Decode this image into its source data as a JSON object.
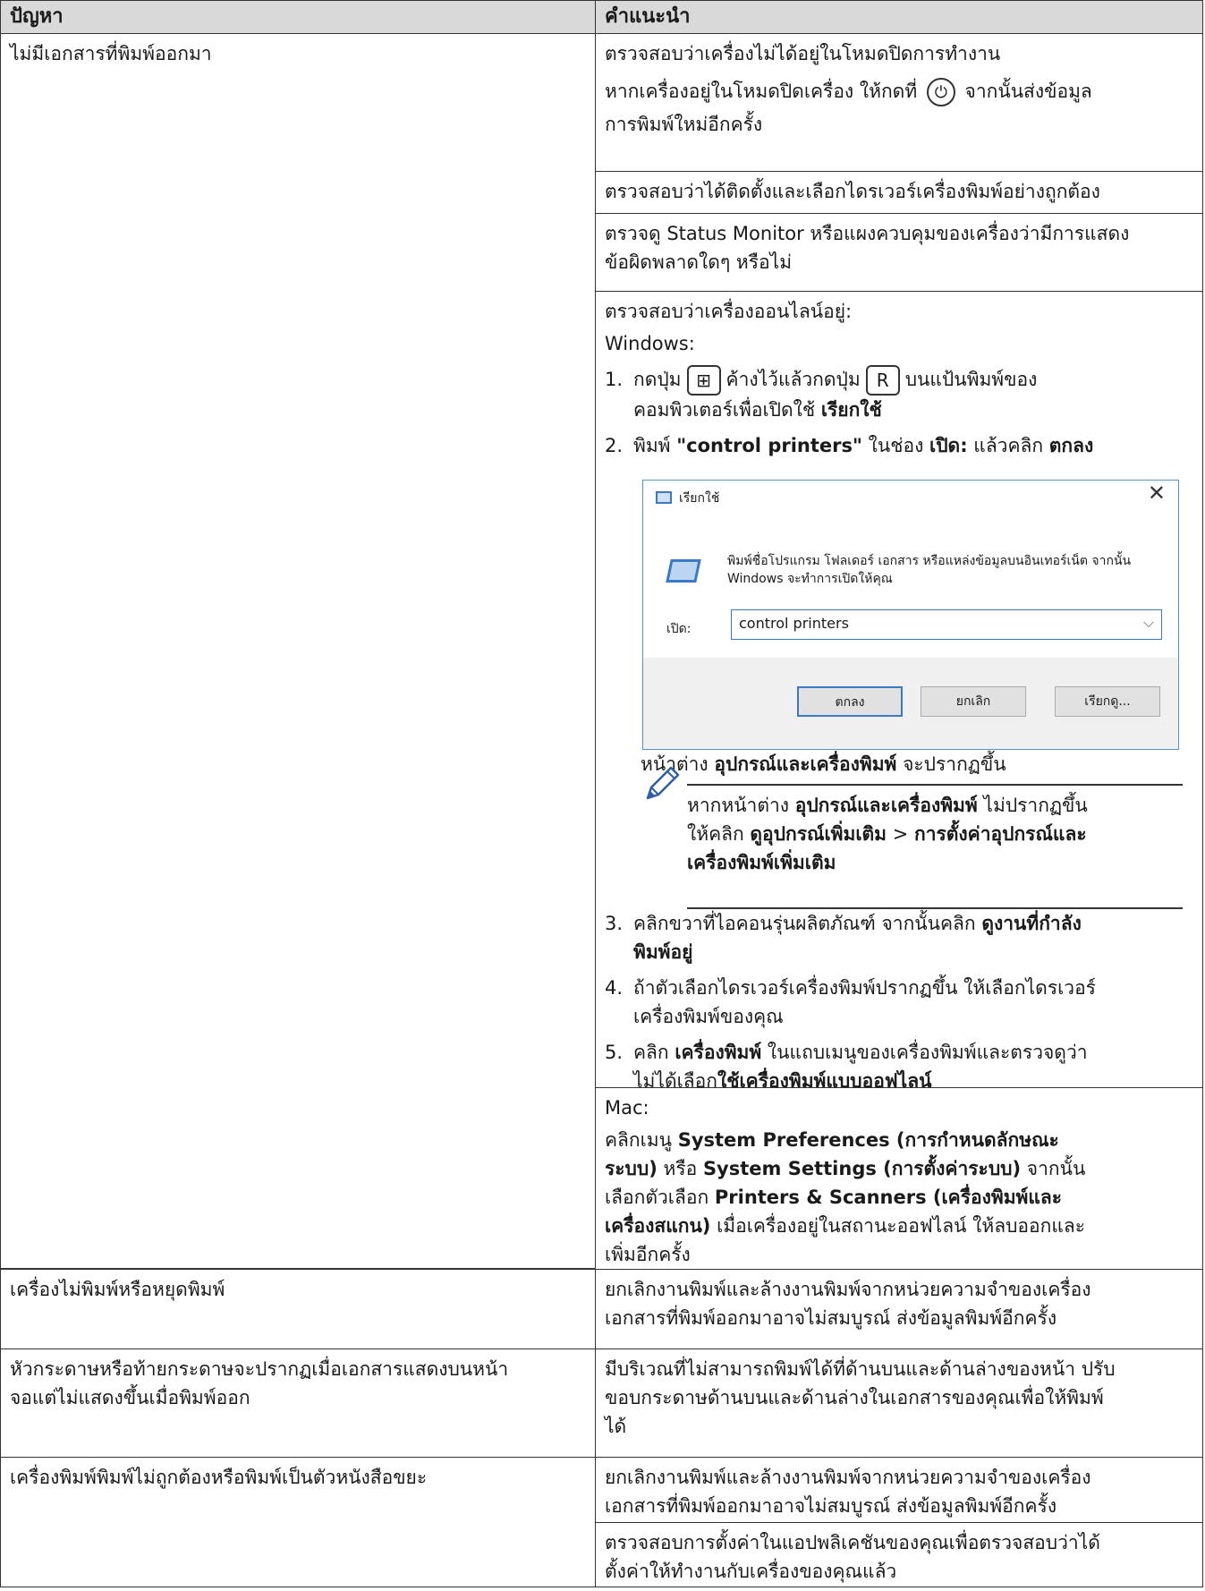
{
  "header": {
    "col1": "ปัญหา",
    "col2": "คำแนะนำ"
  },
  "row1": {
    "problem": "ไม่มีเอกสารที่พิมพ์ออกมา",
    "s1": "ตรวจสอบว่าเครื่องไม่ได้อยู่ในโหมดปิดการทำงาน",
    "s2a": "หากเครื่องอยู่ในโหมดปิดเครื่อง ให้กดที่",
    "s2b": "จากนั้นส่งข้อมูล",
    "s2c": "การพิมพ์ใหม่อีกครั้ง",
    "s3": "ตรวจสอบว่าได้ติดตั้งและเลือกไดรเวอร์เครื่องพิมพ์อย่างถูกต้อง",
    "s4a": "ตรวจดู Status Monitor หรือแผงควบคุมของเครื่องว่ามีการแสดง",
    "s4b": "ข้อผิดพลาดใดๆ หรือไม่",
    "s5": "ตรวจสอบว่าเครื่องออนไลน์อยู่:",
    "windows": "Windows:",
    "step1a": "กดปุ่ม",
    "step1b": "ค้างไว้แล้วกดปุ่ม",
    "step1c": "บนแป้นพิมพ์ของ",
    "step1d": "คอมพิวเตอร์เพื่อเปิดใช้",
    "step1e": "เรียกใช้",
    "step2a": "พิมพ์",
    "step2b": "\"control printers\"",
    "step2c": "ในช่อง",
    "step2d": "เปิด:",
    "step2e": "แล้วคลิก",
    "step2f": "ตกลง",
    "after_dialog_a": "หน้าต่าง",
    "after_dialog_b": "อุปกรณ์และเครื่องพิมพ์",
    "after_dialog_c": "จะปรากฏขึ้น",
    "note_a": "หากหน้าต่าง",
    "note_b": "อุปกรณ์และเครื่องพิมพ์",
    "note_c": "ไม่ปรากฏขึ้น",
    "note_d": "ให้คลิก",
    "note_e": "ดูอุปกรณ์เพิ่มเติม",
    "note_f": ">",
    "note_g": "การตั้งค่าอุปกรณ์และ",
    "note_h": "เครื่องพิมพ์เพิ่มเติม",
    "step3a": "คลิกขวาที่ไอคอนรุ่นผลิตภัณฑ์ จากนั้นคลิก",
    "step3b": "ดูงานที่กำลัง",
    "step3c": "พิมพ์อยู่",
    "step4a": "ถ้าตัวเลือกไดรเวอร์เครื่องพิมพ์ปรากฏขึ้น ให้เลือกไดรเวอร์",
    "step4b": "เครื่องพิมพ์ของคุณ",
    "step5a": "คลิก",
    "step5b": "เครื่องพิมพ์",
    "step5c": "ในแถบเมนูของเครื่องพิมพ์และตรวจดูว่า",
    "step5d": "ไม่ได้เลือก",
    "step5e": "ใช้เครื่องพิมพ์แบบออฟไลน์",
    "mac": "Mac:",
    "mac_a": "คลิกเมนู",
    "mac_b": "System Preferences (การกำหนดลักษณะ",
    "mac_c": "ระบบ)",
    "mac_d": "หรือ",
    "mac_e": "System Settings (การตั้งค่าระบบ)",
    "mac_f": "จากนั้น",
    "mac_g": "เลือกตัวเลือก",
    "mac_h": "Printers & Scanners (เครื่องพิมพ์และ",
    "mac_i": "เครื่องสแกน)",
    "mac_j": "เมื่อเครื่องอยู่ในสถานะออฟไลน์ ให้ลบออกและ",
    "mac_k": "เพิ่มอีกครั้ง"
  },
  "dialog": {
    "title": "เรียกใช้",
    "close": "✕",
    "desc": "พิมพ์ชื่อโปรแกรม โฟลเดอร์ เอกสาร หรือแหล่งข้อมูลบนอินเทอร์เน็ต จากนั้น Windows จะทำการเปิดให้คุณ",
    "open_label": "เปิด:",
    "input_value": "control printers",
    "ok": "ตกลง",
    "cancel": "ยกเลิก",
    "browse": "เรียกดู..."
  },
  "row2": {
    "problem": "เครื่องไม่พิมพ์หรือหยุดพิมพ์",
    "a": "ยกเลิกงานพิมพ์และล้างงานพิมพ์จากหน่วยความจำของเครื่อง",
    "b": "เอกสารที่พิมพ์ออกมาอาจไม่สมบูรณ์ ส่งข้อมูลพิมพ์อีกครั้ง"
  },
  "row3": {
    "problem_a": "หัวกระดาษหรือท้ายกระดาษจะปรากฏเมื่อเอกสารแสดงบนหน้า",
    "problem_b": "จอแต่ไม่แสดงขึ้นเมื่อพิมพ์ออก",
    "a": "มีบริเวณที่ไม่สามารถพิมพ์ได้ที่ด้านบนและด้านล่างของหน้า ปรับ",
    "b": "ขอบกระดาษด้านบนและด้านล่างในเอกสารของคุณเพื่อให้พิมพ์",
    "c": "ได้"
  },
  "row4": {
    "problem": "เครื่องพิมพ์พิมพ์ไม่ถูกต้องหรือพิมพ์เป็นตัวหนังสือขยะ",
    "a": "ยกเลิกงานพิมพ์และล้างงานพิมพ์จากหน่วยความจำของเครื่อง",
    "b": "เอกสารที่พิมพ์ออกมาอาจไม่สมบูรณ์ ส่งข้อมูลพิมพ์อีกครั้ง",
    "c": "ตรวจสอบการตั้งค่าในแอปพลิเคชันของคุณเพื่อตรวจสอบว่าได้",
    "d": "ตั้งค่าให้ทำงานกับเครื่องของคุณแล้ว"
  },
  "icons": {
    "power": "power-icon",
    "windows": "windows-key-icon",
    "rkey": "R"
  }
}
